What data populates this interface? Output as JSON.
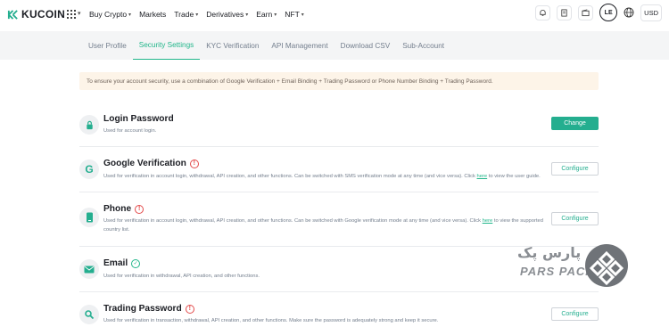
{
  "header": {
    "brand": "KUCOIN",
    "nav": [
      {
        "label": "Buy Crypto",
        "has_caret": true
      },
      {
        "label": "Markets",
        "has_caret": false
      },
      {
        "label": "Trade",
        "has_caret": true
      },
      {
        "label": "Derivatives",
        "has_caret": true
      },
      {
        "label": "Earn",
        "has_caret": true
      },
      {
        "label": "NFT",
        "has_caret": true
      }
    ],
    "avatar_initials": "LE",
    "currency": "USD",
    "icons": [
      "bell-icon",
      "orders-icon",
      "wallet-icon",
      "avatar",
      "globe-icon",
      "currency"
    ]
  },
  "subnav": {
    "tabs": [
      {
        "label": "User Profile",
        "active": false
      },
      {
        "label": "Security Settings",
        "active": true
      },
      {
        "label": "KYC Verification",
        "active": false
      },
      {
        "label": "API Management",
        "active": false
      },
      {
        "label": "Download CSV",
        "active": false
      },
      {
        "label": "Sub-Account",
        "active": false
      }
    ]
  },
  "notice": "To ensure your account security, use a combination of Google Verification + Email Binding + Trading Password or Phone Number Binding + Trading Password.",
  "security_items": [
    {
      "title": "Login Password",
      "icon": "lock-icon",
      "status": "none",
      "desc": "Used for account login.",
      "button": "Change",
      "primary": true
    },
    {
      "title": "Google Verification",
      "icon": "google-icon",
      "status": "warning",
      "desc_before": "Used for verification in account login, withdrawal, API creation, and other functions. Can be switched with SMS verification mode at any time (and vice versa). Click ",
      "link": "here",
      "desc_after": " to view the user guide.",
      "button": "Configure",
      "primary": false
    },
    {
      "title": "Phone",
      "icon": "phone-icon",
      "status": "warning",
      "desc_before": "Used for verification in account login, withdrawal, API creation, and other functions. Can be switched with Google verification mode at any time (and vice versa). Click ",
      "link": "here",
      "desc_after": " to view the supported country list.",
      "button": "Configure",
      "primary": false
    },
    {
      "title": "Email",
      "icon": "mail-icon",
      "status": "verified",
      "desc": "Used for verification in withdrawal, API creation, and other functions.",
      "button": "",
      "primary": false
    },
    {
      "title": "Trading Password",
      "icon": "key-icon",
      "status": "warning",
      "desc": "Used for verification in transaction, withdrawal, API creation, and other functions. Make sure the password is adequately strong and keep it secure.",
      "button": "Configure",
      "primary": false
    }
  ],
  "watermark": {
    "persian": "پارس پک",
    "latin": "PARS PACK"
  },
  "colors": {
    "accent": "#24ae8f",
    "warning": "#e34b4b",
    "notice_bg": "#fdf4e8"
  }
}
